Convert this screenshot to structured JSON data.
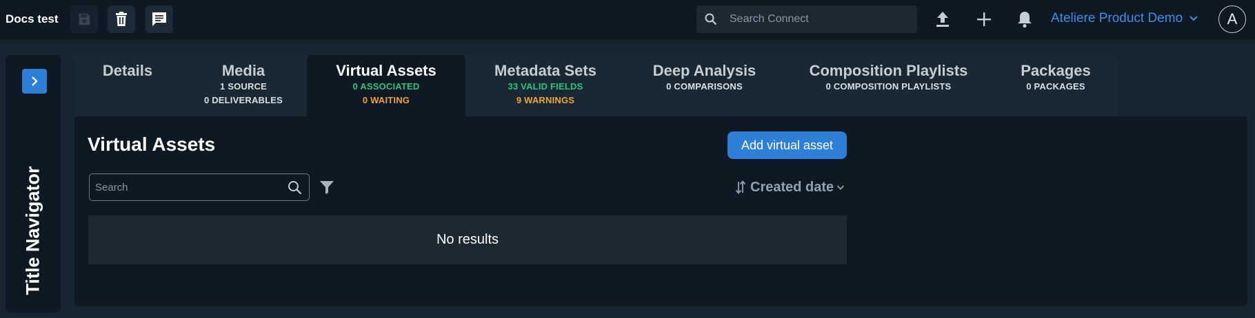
{
  "header": {
    "doc_title": "Docs test",
    "search_placeholder": "Search Connect",
    "org_name": "Ateliere Product Demo",
    "avatar_initial": "A"
  },
  "navigator": {
    "label": "Title Navigator"
  },
  "tabs": [
    {
      "label": "Details",
      "sub1": "",
      "sub2": ""
    },
    {
      "label": "Media",
      "sub1": "1 SOURCE",
      "sub2": "0 DELIVERABLES"
    },
    {
      "label": "Virtual Assets",
      "sub1": "0 ASSOCIATED",
      "sub2": "0 WAITING"
    },
    {
      "label": "Metadata Sets",
      "sub1": "33 VALID FIELDS",
      "sub2": "9 WARNINGS"
    },
    {
      "label": "Deep Analysis",
      "sub1": "0 COMPARISONS",
      "sub2": ""
    },
    {
      "label": "Composition Playlists",
      "sub1": "0 COMPOSITION PLAYLISTS",
      "sub2": ""
    },
    {
      "label": "Packages",
      "sub1": "0 PACKAGES",
      "sub2": ""
    }
  ],
  "active_tab": "Virtual Assets",
  "content": {
    "title": "Virtual Assets",
    "add_button": "Add virtual asset",
    "search_placeholder": "Search",
    "sort_label": "Created date",
    "empty_message": "No results"
  },
  "colors": {
    "accent": "#2d7fd8",
    "org_link": "#3d8fe6",
    "success": "#2ec27e",
    "warning": "#f0a437"
  },
  "icons": [
    "save-icon",
    "trash-icon",
    "comment-icon",
    "search-icon",
    "upload-icon",
    "plus-icon",
    "bell-icon",
    "chevron-down-icon",
    "chevron-right-icon",
    "filter-icon",
    "sort-icon"
  ]
}
